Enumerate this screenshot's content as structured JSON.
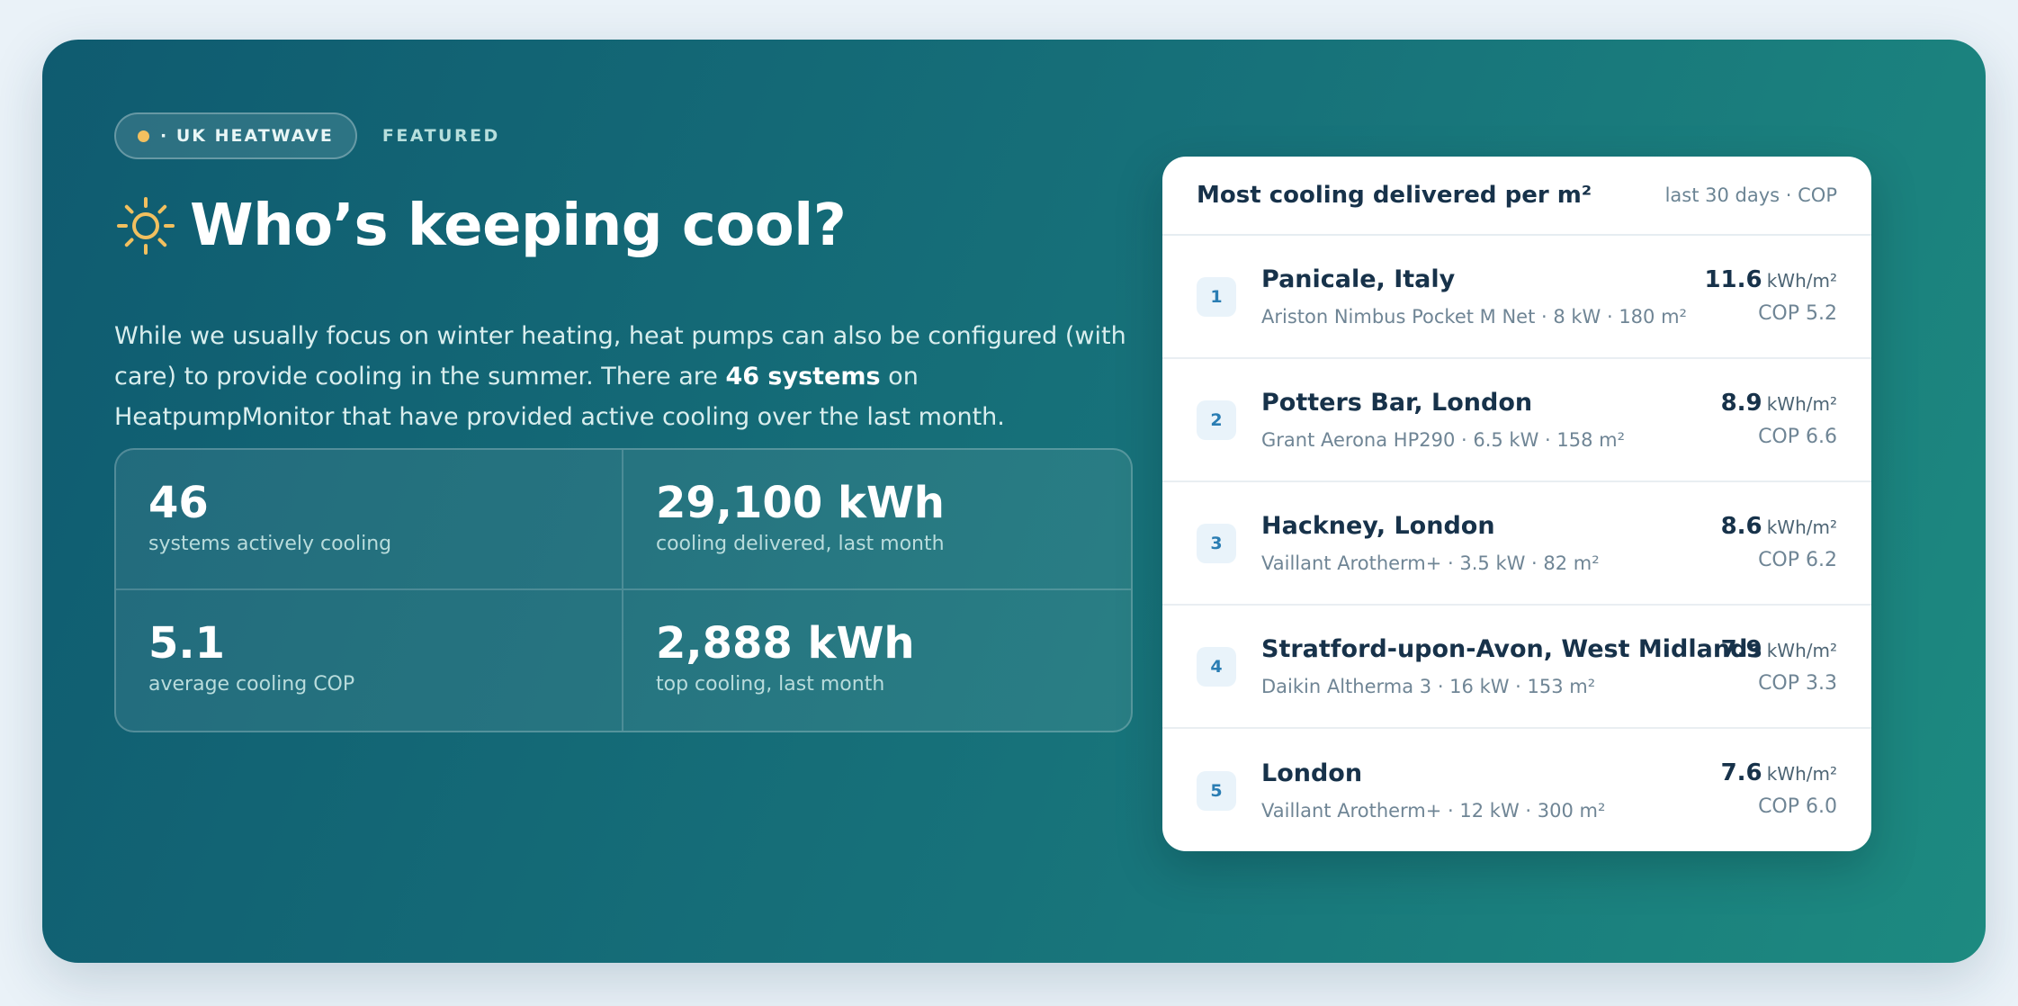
{
  "badge": {
    "label": "· UK HEATWAVE",
    "featured": "FEATURED"
  },
  "title": "Who’s keeping cool?",
  "intro": {
    "part1": "While we usually focus on winter heating, heat pumps can also be configured (with care) to provide cooling in the summer. There are ",
    "bold": "46 systems",
    "part2": " on HeatpumpMonitor that have provided active cooling over the last month."
  },
  "stats": [
    {
      "value": "46",
      "label": "systems actively cooling"
    },
    {
      "value": "29,100 kWh",
      "label": "cooling delivered, last month"
    },
    {
      "value": "5.1",
      "label": "average cooling COP"
    },
    {
      "value": "2,888 kWh",
      "label": "top cooling, last month"
    }
  ],
  "panel": {
    "title": "Most cooling delivered per m²",
    "meta": "last 30 days · COP",
    "rows": [
      {
        "rank": "1",
        "name": "Panicale, Italy",
        "sub": "Ariston Nimbus Pocket M Net · 8 kW · 180 m²",
        "value": "11.6",
        "unit": "kWh/m²",
        "cop": "COP 5.2"
      },
      {
        "rank": "2",
        "name": "Potters Bar, London",
        "sub": "Grant Aerona HP290 · 6.5 kW · 158 m²",
        "value": "8.9",
        "unit": "kWh/m²",
        "cop": "COP 6.6"
      },
      {
        "rank": "3",
        "name": "Hackney, London",
        "sub": "Vaillant Arotherm+ · 3.5 kW · 82 m²",
        "value": "8.6",
        "unit": "kWh/m²",
        "cop": "COP 6.2"
      },
      {
        "rank": "4",
        "name": "Stratford-upon-Avon, West Midlands",
        "sub": "Daikin Altherma 3 · 16 kW · 153 m²",
        "value": "7.9",
        "unit": "kWh/m²",
        "cop": "COP 3.3"
      },
      {
        "rank": "5",
        "name": "London",
        "sub": "Vaillant Arotherm+ · 12 kW · 300 m²",
        "value": "7.6",
        "unit": "kWh/m²",
        "cop": "COP 6.0"
      }
    ]
  },
  "colors": {
    "accent_dot": "#f2c05f",
    "sun": "#f2c05f",
    "card_gradient_start": "#0f5b70",
    "card_gradient_end": "#1d8a80"
  },
  "icons": {
    "sun": "sun-icon",
    "dot": "status-dot-icon"
  }
}
